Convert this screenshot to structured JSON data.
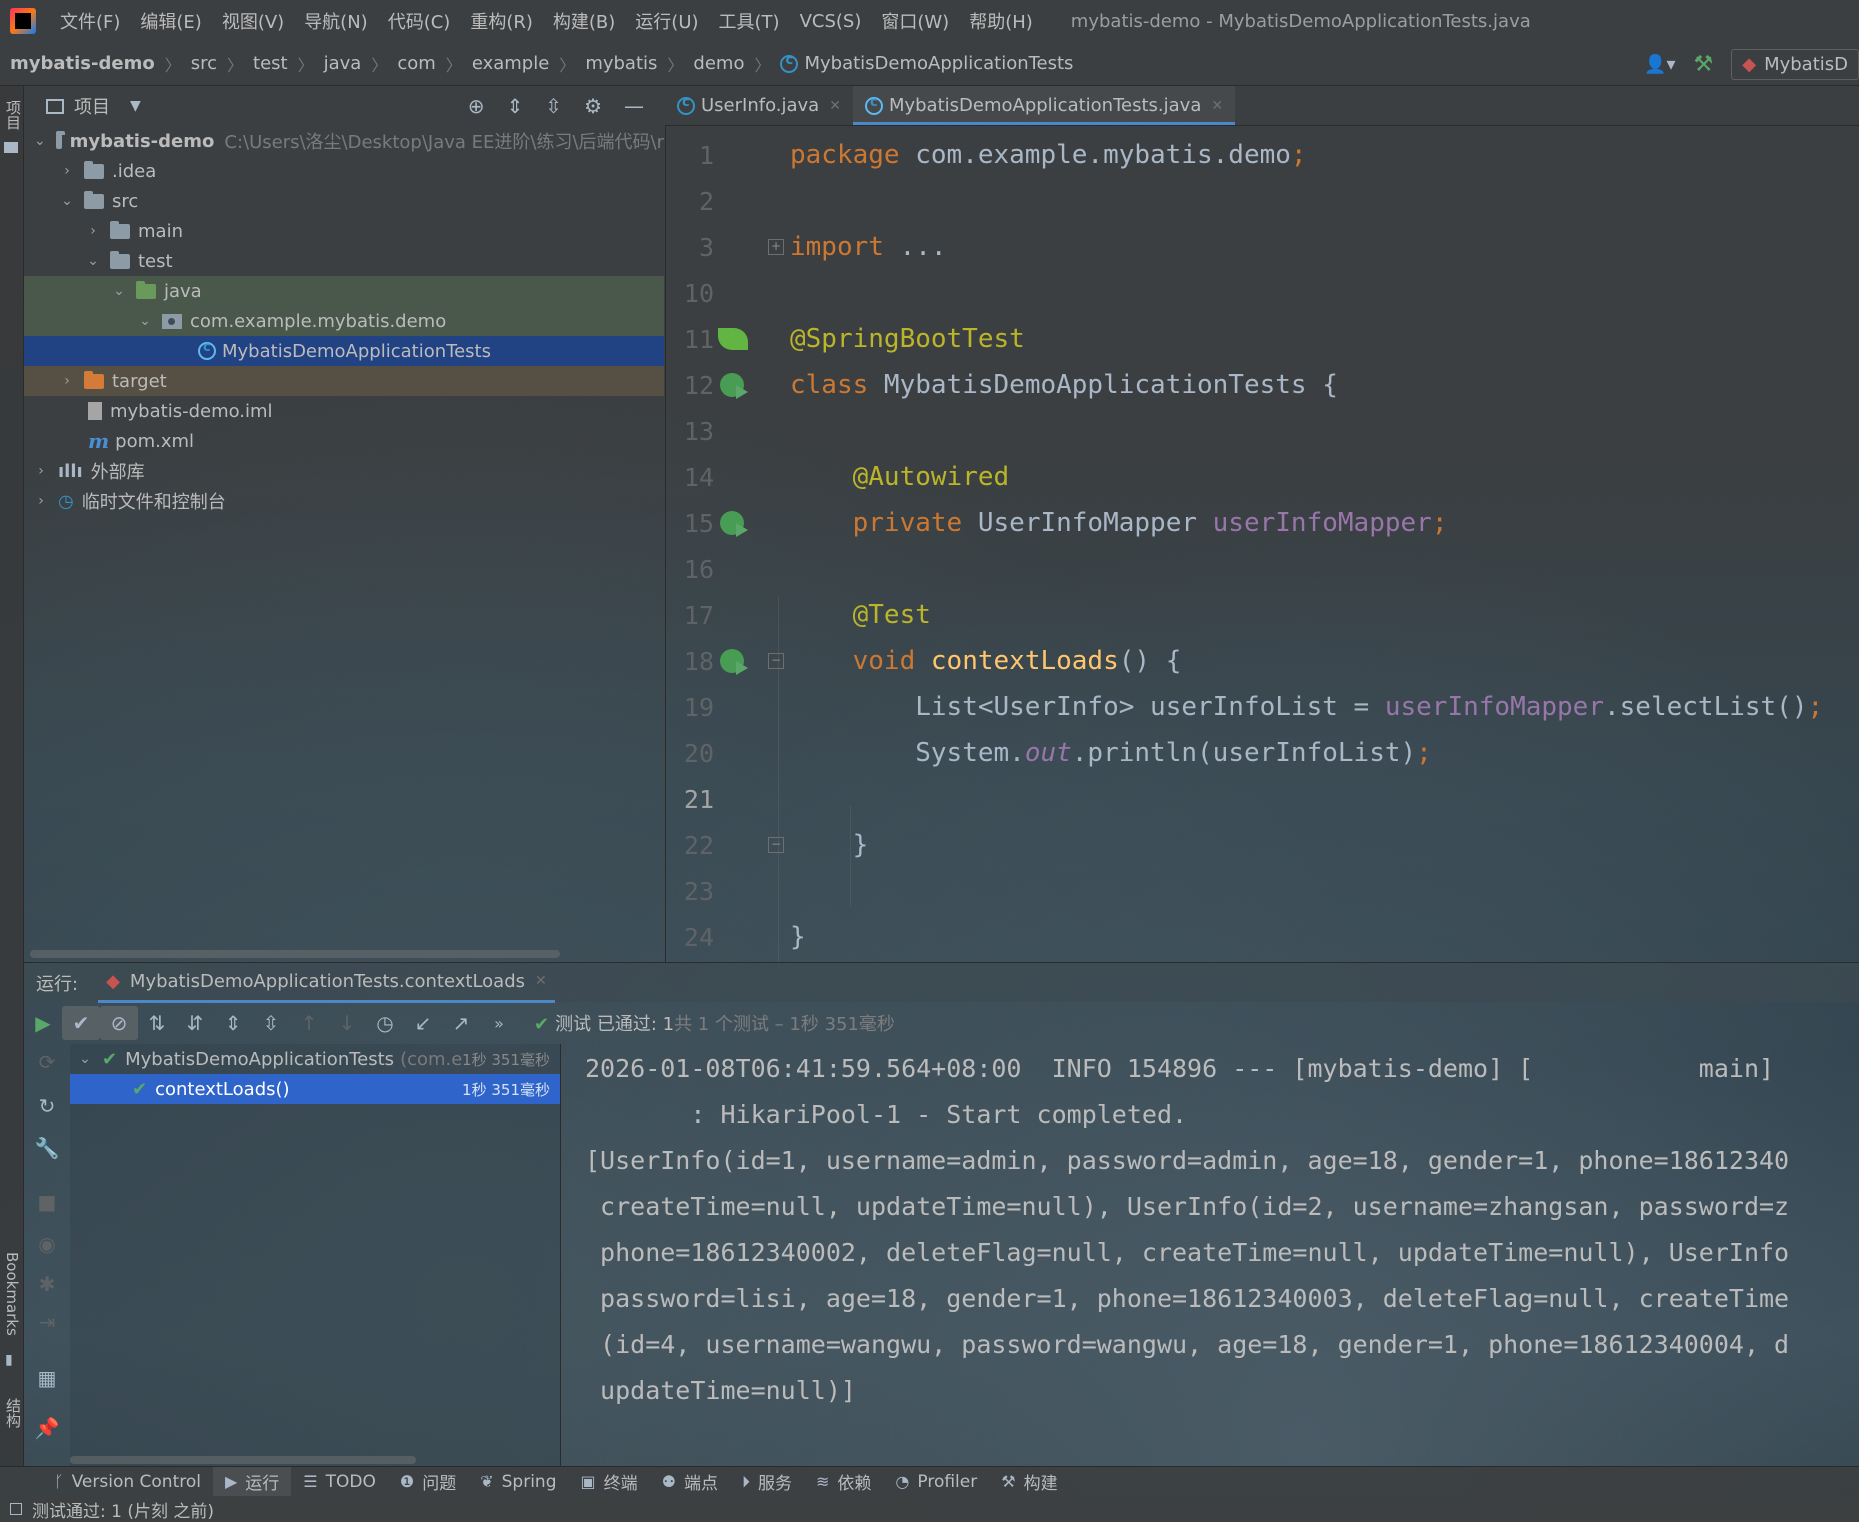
{
  "titlebar": {
    "menus": [
      "文件(F)",
      "编辑(E)",
      "视图(V)",
      "导航(N)",
      "代码(C)",
      "重构(R)",
      "构建(B)",
      "运行(U)",
      "工具(T)",
      "VCS(S)",
      "窗口(W)",
      "帮助(H)"
    ],
    "window_title": "mybatis-demo - MybatisDemoApplicationTests.java"
  },
  "navbar": {
    "crumbs": [
      "mybatis-demo",
      "src",
      "test",
      "java",
      "com",
      "example",
      "mybatis",
      "demo",
      "MybatisDemoApplicationTests"
    ],
    "run_config": "MybatisD"
  },
  "left_stripe": {
    "project_label": "项目",
    "bookmarks_label": "Bookmarks",
    "structure_label": "结构"
  },
  "project": {
    "header": "项目",
    "tree": [
      {
        "label": "mybatis-demo",
        "path": "C:\\Users\\洛尘\\Desktop\\Java EE进阶\\练习\\后端代码\\r"
      },
      {
        "label": ".idea"
      },
      {
        "label": "src"
      },
      {
        "label": "main"
      },
      {
        "label": "test"
      },
      {
        "label": "java"
      },
      {
        "label": "com.example.mybatis.demo"
      },
      {
        "label": "MybatisDemoApplicationTests"
      },
      {
        "label": "target"
      },
      {
        "label": "mybatis-demo.iml"
      },
      {
        "label": "pom.xml"
      },
      {
        "label": "外部库"
      },
      {
        "label": "临时文件和控制台"
      }
    ]
  },
  "tabs": [
    {
      "label": "UserInfo.java"
    },
    {
      "label": "MybatisDemoApplicationTests.java"
    }
  ],
  "editor": {
    "line_numbers": [
      "1",
      "2",
      "3",
      "10",
      "11",
      "12",
      "13",
      "14",
      "15",
      "16",
      "17",
      "18",
      "19",
      "20",
      "21",
      "22",
      "23",
      "24"
    ],
    "tokens": {
      "package_kw": "package",
      "package_name": " com.example.mybatis.demo",
      "semicolon": ";",
      "import_kw": "import",
      "import_rest": " ...",
      "ann_springboot": "@SpringBootTest",
      "class_kw": "class",
      "class_name": " MybatisDemoApplicationTests {",
      "ann_autowired": "@Autowired",
      "private_kw": "private",
      "field_type": " UserInfoMapper ",
      "field_name": "userInfoMapper",
      "ann_test": "@Test",
      "void_kw": "void",
      "method_name": " contextLoads",
      "method_rest": "() {",
      "l19_a": "List<UserInfo> userInfoList = ",
      "l19_b": "userInfoMapper",
      "l19_c": ".selectList()",
      "l20_a": "System.",
      "l20_b": "out",
      "l20_c": ".println(userInfoList)",
      "close_inner": "}",
      "close_outer": "}"
    }
  },
  "run": {
    "label": "运行:",
    "tab": "MybatisDemoApplicationTests.contextLoads",
    "status_passed": "测试 已通过: 1",
    "status_detail": "共 1 个测试 – 1秒 351毫秒",
    "tree": [
      {
        "label": "MybatisDemoApplicationTests",
        "sub": "(com.e",
        "time": "1秒 351毫秒"
      },
      {
        "label": "contextLoads()",
        "time": "1秒 351毫秒"
      }
    ],
    "console": [
      "2026-01-08T06:41:59.564+08:00  INFO 154896 --- [mybatis-demo] [           main]",
      "       : HikariPool-1 - Start completed.",
      "[UserInfo(id=1, username=admin, password=admin, age=18, gender=1, phone=18612340",
      " createTime=null, updateTime=null), UserInfo(id=2, username=zhangsan, password=z",
      " phone=18612340002, deleteFlag=null, createTime=null, updateTime=null), UserInfo",
      " password=lisi, age=18, gender=1, phone=18612340003, deleteFlag=null, createTime",
      " (id=4, username=wangwu, password=wangwu, age=18, gender=1, phone=18612340004, d",
      " updateTime=null)]"
    ]
  },
  "bottom_tools": [
    "Version Control",
    "运行",
    "TODO",
    "问题",
    "Spring",
    "终端",
    "端点",
    "服务",
    "依赖",
    "Profiler",
    "构建"
  ],
  "status": "测试通过: 1 (片刻 之前)",
  "colors": {
    "keyword": "#cc7832",
    "annotation": "#bbb529",
    "field": "#9876aa",
    "method": "#ffc66d",
    "text": "#a9b7c6",
    "selection": "#214283",
    "pass": "#59a869"
  }
}
